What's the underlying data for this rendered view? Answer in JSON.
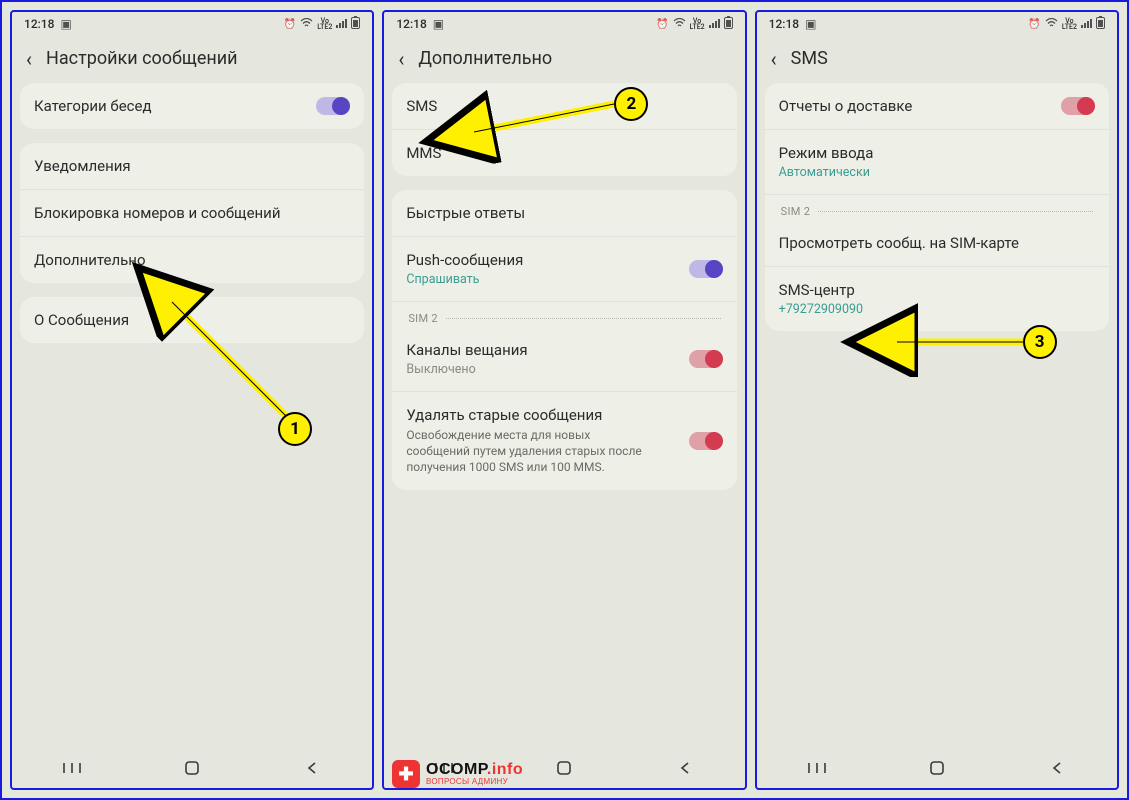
{
  "status": {
    "time": "12:18",
    "lte": "LTE2",
    "vo": "Vo"
  },
  "panel1": {
    "title": "Настройки сообщений",
    "items": {
      "categories": "Категории бесед",
      "notifications": "Уведомления",
      "block": "Блокировка номеров и сообщений",
      "advanced": "Дополнительно",
      "about": "О Сообщения"
    }
  },
  "panel2": {
    "title": "Дополнительно",
    "items": {
      "sms": "SMS",
      "mms": "MMS",
      "quick": "Быстрые ответы",
      "push": "Push-сообщения",
      "push_sub": "Спрашивать",
      "sim2": "SIM 2",
      "channels": "Каналы вещания",
      "channels_sub": "Выключено",
      "delete_old": "Удалять старые сообщения",
      "delete_desc": "Освобождение места для новых сообщений путем удаления старых после получения 1000 SMS или 100 MMS."
    }
  },
  "panel3": {
    "title": "SMS",
    "items": {
      "delivery": "Отчеты о доставке",
      "input_mode": "Режим ввода",
      "input_sub": "Автоматически",
      "sim2": "SIM 2",
      "view_sim": "Просмотреть сообщ. на SIM-карте",
      "sms_center": "SMS-центр",
      "sms_center_val": "+79272909090"
    }
  },
  "badges": {
    "b1": "1",
    "b2": "2",
    "b3": "3"
  },
  "watermark": {
    "main1": "OCOMP",
    "main2": ".info",
    "sub": "ВОПРОСЫ АДМИНУ"
  }
}
